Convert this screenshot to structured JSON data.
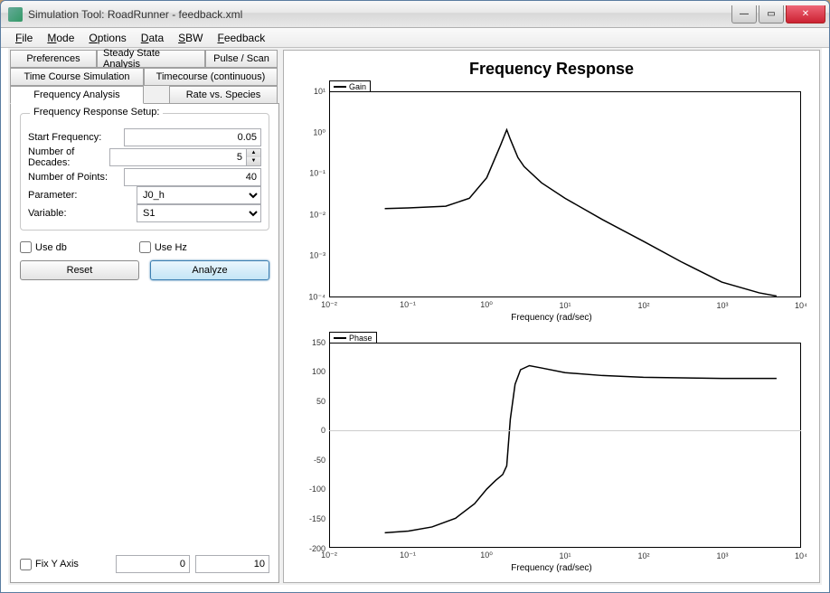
{
  "window": {
    "title": "Simulation Tool: RoadRunner - feedback.xml"
  },
  "menu": [
    "File",
    "Mode",
    "Options",
    "Data",
    "SBW",
    "Feedback"
  ],
  "tabs": {
    "row1": [
      "Preferences",
      "Steady State Analysis",
      "Pulse / Scan"
    ],
    "row2": [
      "Time Course Simulation",
      "Timecourse (continuous)"
    ],
    "row3": [
      "Frequency Analysis",
      "Rate vs. Species"
    ]
  },
  "form": {
    "group_title": "Frequency Response Setup:",
    "start_freq_label": "Start Frequency:",
    "start_freq_value": "0.05",
    "num_decades_label": "Number of Decades:",
    "num_decades_value": "5",
    "num_points_label": "Number of Points:",
    "num_points_value": "40",
    "parameter_label": "Parameter:",
    "parameter_value": "J0_h",
    "variable_label": "Variable:",
    "variable_value": "S1",
    "use_db_label": "Use db",
    "use_hz_label": "Use Hz",
    "reset_label": "Reset",
    "analyze_label": "Analyze",
    "fix_y_label": "Fix Y Axis",
    "fix_y_min": "0",
    "fix_y_max": "10"
  },
  "chart": {
    "title": "Frequency Response",
    "xlabel": "Frequency (rad/sec)",
    "gain_legend": "Gain",
    "phase_legend": "Phase",
    "x_ticks": [
      "10⁻²",
      "10⁻¹",
      "10⁰",
      "10¹",
      "10²",
      "10³",
      "10⁴"
    ],
    "gain_y_ticks": [
      "10⁻⁴",
      "10⁻³",
      "10⁻²",
      "10⁻¹",
      "10⁰",
      "10¹"
    ],
    "phase_y_ticks": [
      "-200",
      "-150",
      "-100",
      "-50",
      "0",
      "50",
      "100",
      "150"
    ]
  },
  "chart_data": [
    {
      "type": "line",
      "name": "Gain",
      "xlabel": "Frequency (rad/sec)",
      "xscale": "log",
      "yscale": "log",
      "xlim": [
        0.01,
        10000
      ],
      "ylim": [
        0.0001,
        10
      ],
      "x": [
        0.05,
        0.1,
        0.3,
        0.6,
        1.0,
        1.5,
        1.8,
        2.0,
        2.5,
        3.0,
        5.0,
        10,
        30,
        100,
        300,
        1000,
        3000,
        5000
      ],
      "gain": [
        0.014,
        0.0145,
        0.016,
        0.025,
        0.08,
        0.5,
        1.2,
        0.7,
        0.25,
        0.15,
        0.06,
        0.025,
        0.0075,
        0.0022,
        0.0007,
        0.00022,
        0.00012,
        0.0001
      ]
    },
    {
      "type": "line",
      "name": "Phase",
      "xlabel": "Frequency (rad/sec)",
      "xscale": "log",
      "yscale": "linear",
      "xlim": [
        0.01,
        10000
      ],
      "ylim": [
        -200,
        150
      ],
      "x": [
        0.05,
        0.1,
        0.2,
        0.4,
        0.7,
        1.0,
        1.3,
        1.6,
        1.8,
        2.0,
        2.3,
        2.7,
        3.5,
        5.0,
        10,
        30,
        100,
        1000,
        5000
      ],
      "phase": [
        -175,
        -172,
        -165,
        -150,
        -125,
        -100,
        -85,
        -75,
        -60,
        20,
        80,
        105,
        112,
        108,
        100,
        95,
        92,
        90,
        90
      ]
    }
  ]
}
